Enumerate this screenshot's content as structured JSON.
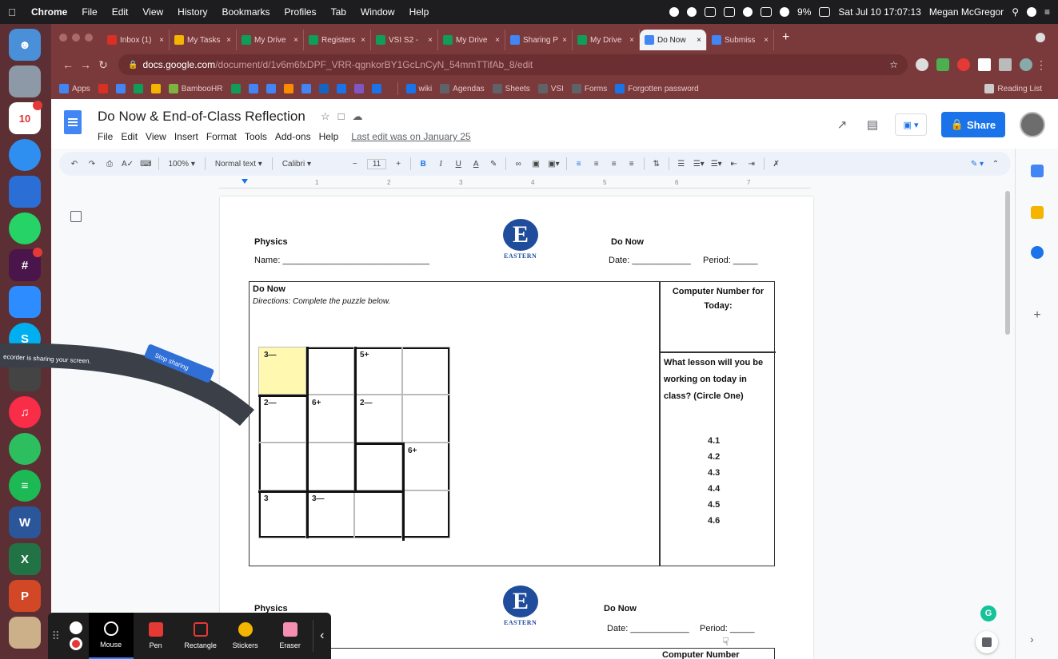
{
  "menubar": {
    "app": "Chrome",
    "items": [
      "File",
      "Edit",
      "View",
      "History",
      "Bookmarks",
      "Profiles",
      "Tab",
      "Window",
      "Help"
    ],
    "battery": "9%",
    "clock": "Sat Jul 10 17:07:13",
    "user": "Megan McGregor"
  },
  "tabs": [
    {
      "label": "Inbox (1)",
      "color": "#d93025"
    },
    {
      "label": "My Tasks",
      "color": "#f4b400"
    },
    {
      "label": "My Drive",
      "color": "#0f9d58"
    },
    {
      "label": "Registers",
      "color": "#0f9d58"
    },
    {
      "label": "VSI S2 -",
      "color": "#0f9d58"
    },
    {
      "label": "My Drive",
      "color": "#0f9d58"
    },
    {
      "label": "Sharing P",
      "color": "#4285f4"
    },
    {
      "label": "My Drive",
      "color": "#0f9d58"
    },
    {
      "label": "Do Now",
      "color": "#4285f4",
      "active": true
    },
    {
      "label": "Submiss",
      "color": "#4285f4"
    }
  ],
  "address": {
    "host": "docs.google.com",
    "path": "/document/d/1v6m6fxDPF_VRR-qgnkorBY1GcLnCyN_54mmTTifAb_8/edit"
  },
  "bookmarks": {
    "items": [
      {
        "label": "Apps",
        "color": "#4285f4"
      },
      {
        "label": "",
        "color": "#d93025"
      },
      {
        "label": "",
        "color": "#4285f4"
      },
      {
        "label": "",
        "color": "#0f9d58"
      },
      {
        "label": "",
        "color": "#f4b400"
      },
      {
        "label": "BambooHR",
        "color": "#7cb342"
      },
      {
        "label": "",
        "color": "#0f9d58"
      },
      {
        "label": "",
        "color": "#4285f4"
      },
      {
        "label": "",
        "color": "#4285f4"
      },
      {
        "label": "",
        "color": "#fb8c00"
      },
      {
        "label": "",
        "color": "#4285f4"
      },
      {
        "label": "",
        "color": "#1565c0"
      },
      {
        "label": "",
        "color": "#1a73e8"
      },
      {
        "label": "",
        "color": "#7e57c2"
      },
      {
        "label": "",
        "color": "#1a73e8"
      }
    ],
    "folders": [
      {
        "label": "wiki",
        "color": "#1a73e8"
      },
      {
        "label": "Agendas",
        "color": "#5f6368"
      },
      {
        "label": "Sheets",
        "color": "#5f6368"
      },
      {
        "label": "VSI",
        "color": "#5f6368"
      },
      {
        "label": "Forms",
        "color": "#5f6368"
      },
      {
        "label": "Forgotten password",
        "color": "#1a73e8"
      }
    ],
    "reading_list": "Reading List"
  },
  "docs": {
    "title": "Do Now & End-of-Class Reflection",
    "menus": [
      "File",
      "Edit",
      "View",
      "Insert",
      "Format",
      "Tools",
      "Add-ons",
      "Help"
    ],
    "last_edit": "Last edit was on January 25",
    "share_label": "Share",
    "toolbar": {
      "zoom": "100%",
      "style": "Normal text",
      "font": "Calibri",
      "size": "11"
    },
    "ruler_numbers": [
      "1",
      "2",
      "3",
      "4",
      "5",
      "6",
      "7"
    ]
  },
  "page": {
    "subject": "Physics",
    "name_label": "Name: ______________________________",
    "header_title": "Do Now",
    "date_label": "Date: ____________",
    "period_label": "Period: _____",
    "school": "EASTERN",
    "box_title": "Do Now",
    "directions": "Directions: Complete the puzzle below.",
    "computer_number": "Computer Number for Today:",
    "lesson_question": "What lesson will you be working on today in class? (Circle One)",
    "lesson_options": [
      "4.1",
      "4.2",
      "4.3",
      "4.4",
      "4.5",
      "4.6"
    ],
    "second_subject": "Physics",
    "second_title": "Do Now",
    "second_date": "Date: ____________",
    "second_period": "Period: _____",
    "second_computer": "Computer Number"
  },
  "kenken": {
    "cells": [
      {
        "r": 0,
        "c": 0,
        "clue": "3—",
        "highlight": true
      },
      {
        "r": 0,
        "c": 2,
        "clue": "5+"
      },
      {
        "r": 1,
        "c": 0,
        "clue": "2—"
      },
      {
        "r": 1,
        "c": 1,
        "clue": "6+"
      },
      {
        "r": 1,
        "c": 2,
        "clue": "2—"
      },
      {
        "r": 2,
        "c": 3,
        "clue": "6+"
      },
      {
        "r": 3,
        "c": 0,
        "clue": "3"
      },
      {
        "r": 3,
        "c": 1,
        "clue": "3—"
      }
    ]
  },
  "recorder": {
    "banner": "ecorder is sharing your screen.",
    "stop_label": "Stop sharing",
    "hide_label": "Hide",
    "tools": [
      {
        "label": "Mouse",
        "color": "#ffffff",
        "active": true
      },
      {
        "label": "Pen",
        "color": "#e53935"
      },
      {
        "label": "Rectangle",
        "color": "#e53935"
      },
      {
        "label": "Stickers",
        "color": "#f4b400"
      },
      {
        "label": "Eraser",
        "color": "#f48fb1"
      }
    ]
  }
}
